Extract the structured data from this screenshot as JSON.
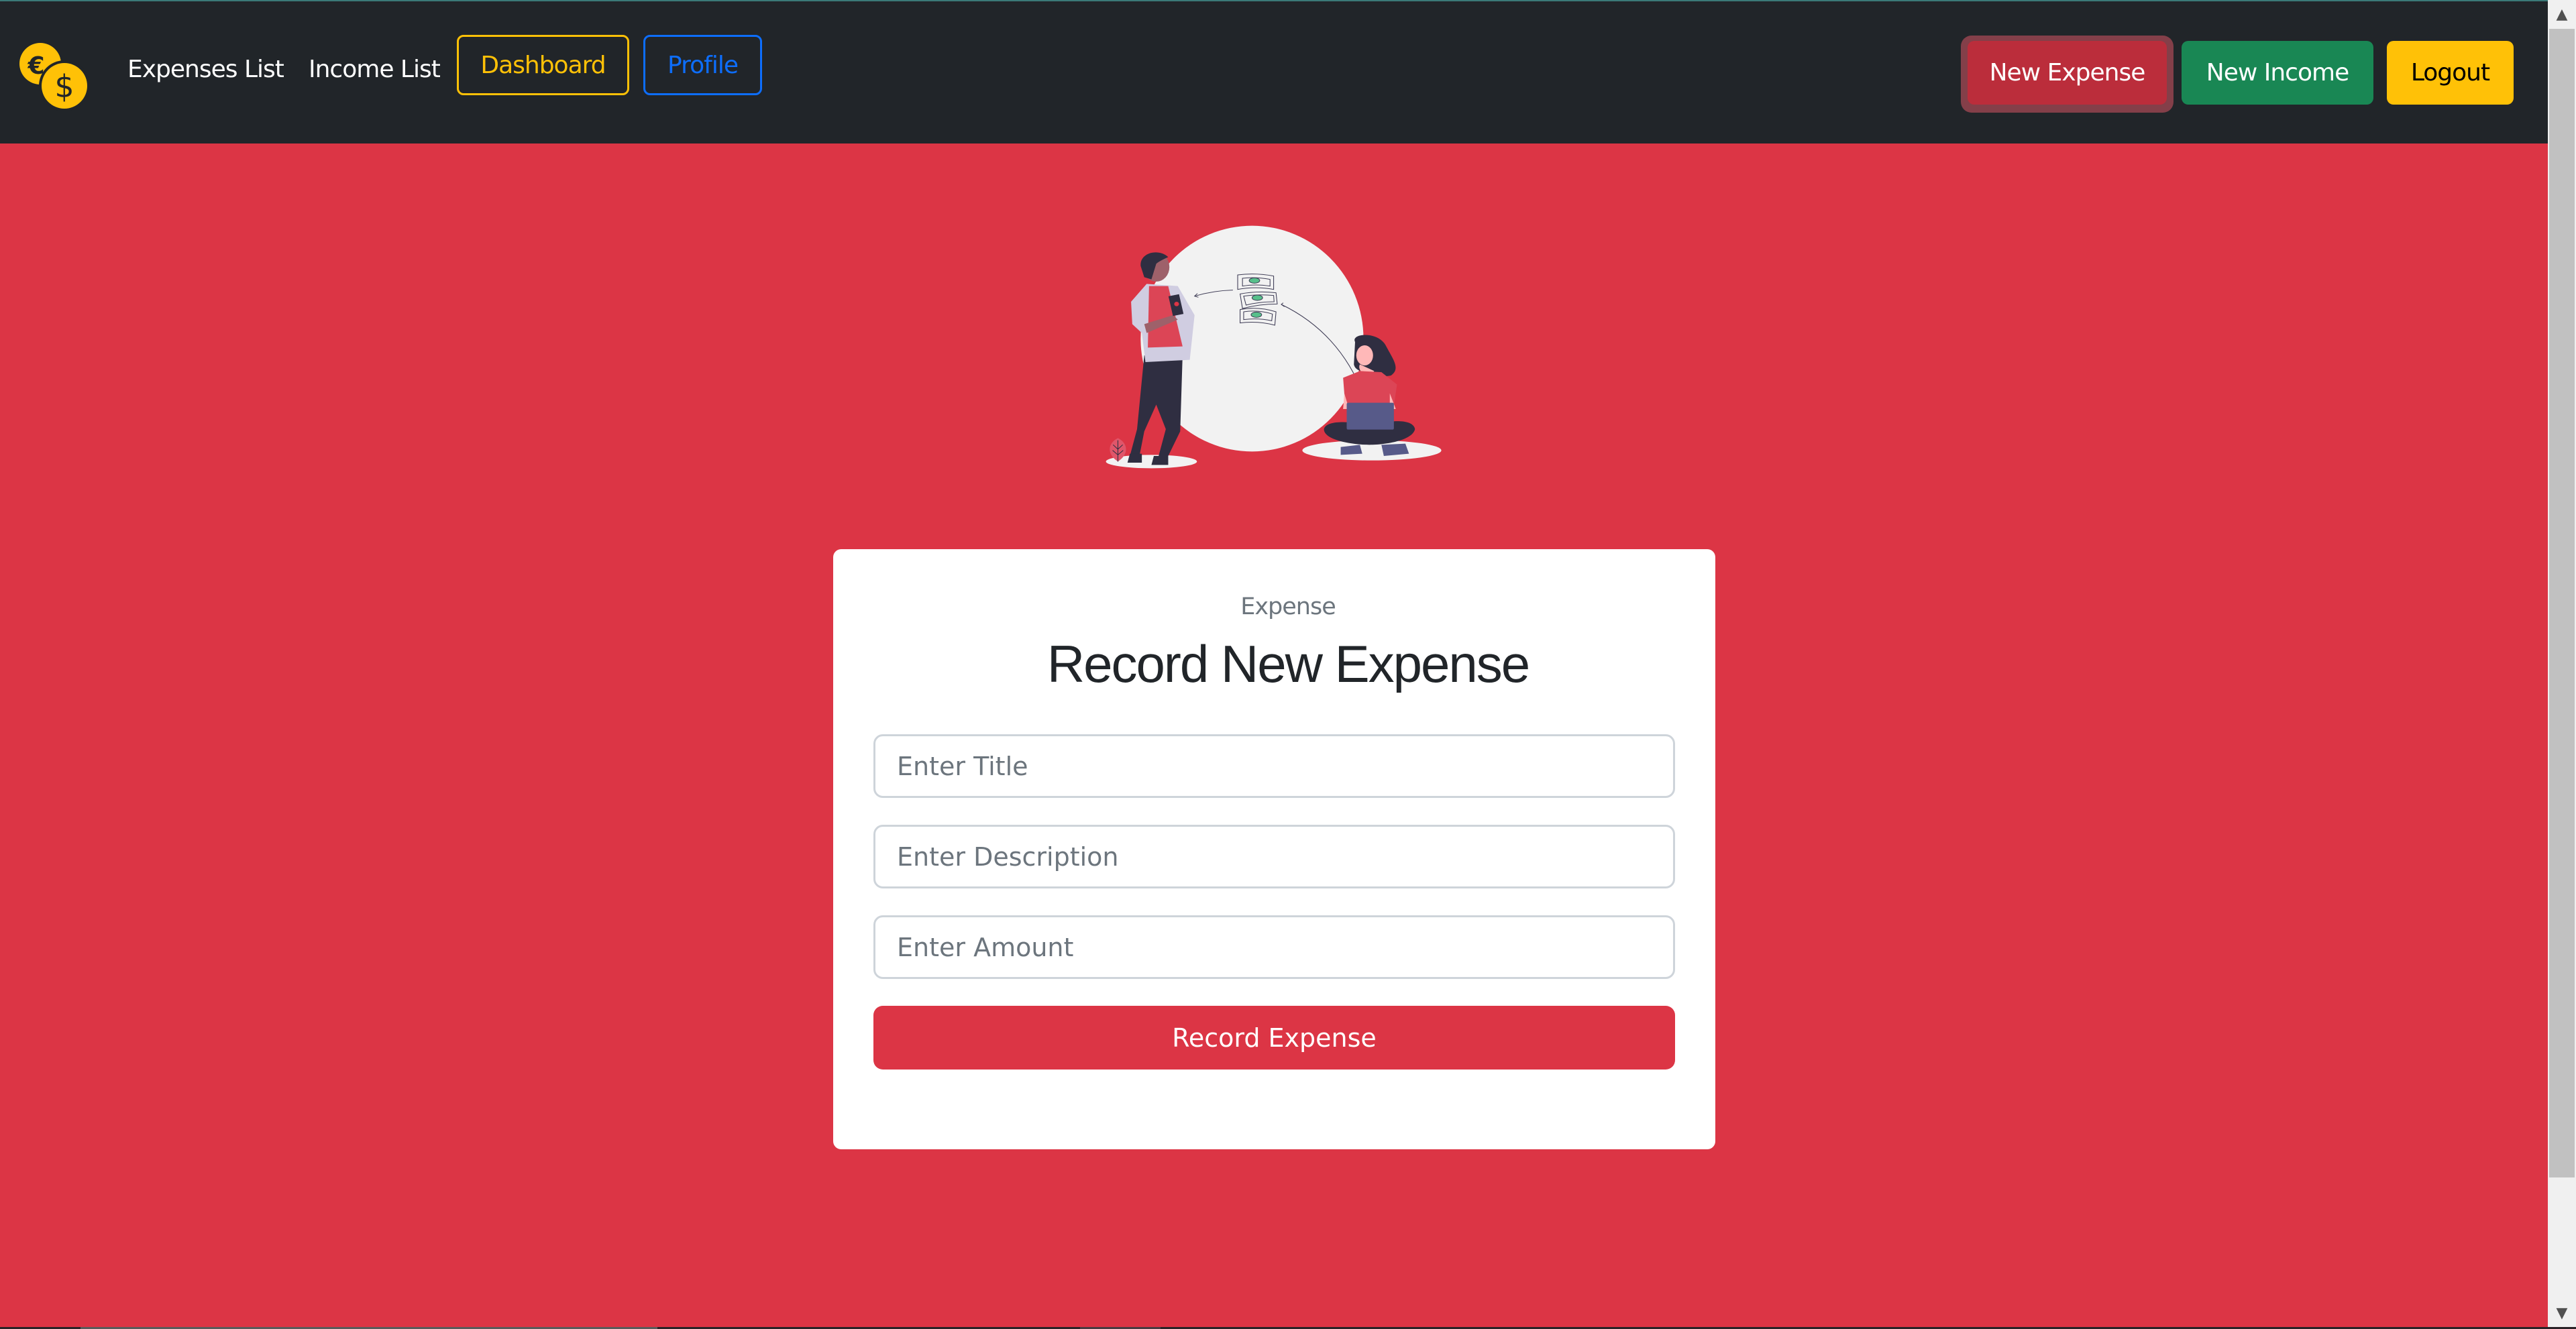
{
  "navbar": {
    "logo_icon": "euro-dollar-coins-icon",
    "links": [
      {
        "label": "Expenses List"
      },
      {
        "label": "Income List"
      }
    ],
    "dashboard_label": "Dashboard",
    "profile_label": "Profile",
    "new_expense_label": "New Expense",
    "new_income_label": "New Income",
    "logout_label": "Logout"
  },
  "colors": {
    "navbar_bg": "#212529",
    "page_bg": "#dc3545",
    "warning": "#ffc107",
    "primary": "#0d6efd",
    "danger": "#dc3545",
    "success": "#198754"
  },
  "illustration": {
    "icon": "money-transfer-illustration"
  },
  "form": {
    "subtitle": "Expense",
    "title": "Record New Expense",
    "title_placeholder": "Enter Title",
    "description_placeholder": "Enter Description",
    "amount_placeholder": "Enter Amount",
    "submit_label": "Record Expense"
  },
  "scrollbar": {
    "up_icon": "▲",
    "down_icon": "▼"
  }
}
